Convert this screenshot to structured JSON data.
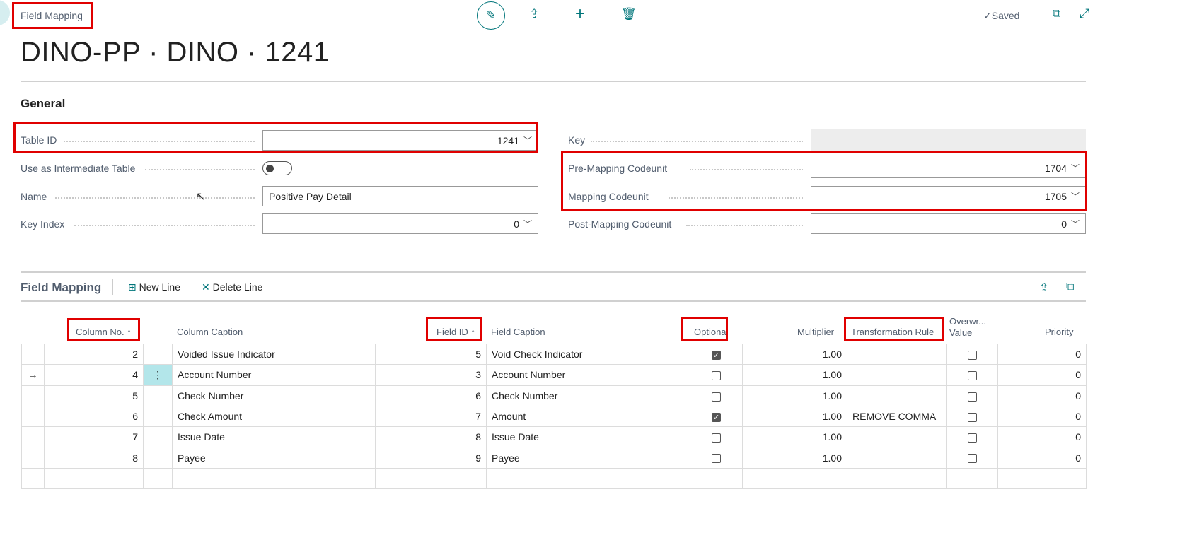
{
  "header": {
    "breadcrumb": "Field Mapping",
    "status": "Saved",
    "title": "DINO-PP · DINO · 1241"
  },
  "icons": {
    "edit": "pencil-icon",
    "share": "share-icon",
    "new": "plus-icon",
    "delete": "trash-icon",
    "saved": "check-icon",
    "open_new": "open-new-window-icon",
    "expand": "expand-icon"
  },
  "general": {
    "section_title": "General",
    "table_id": {
      "label": "Table ID",
      "value": "1241"
    },
    "use_as_intermediate": {
      "label": "Use as Intermediate Table",
      "value": false
    },
    "name": {
      "label": "Name",
      "value": "Positive Pay Detail"
    },
    "key_index": {
      "label": "Key Index",
      "value": "0"
    },
    "key": {
      "label": "Key",
      "value": ""
    },
    "pre_mapping": {
      "label": "Pre-Mapping Codeunit",
      "value": "1704"
    },
    "mapping": {
      "label": "Mapping Codeunit",
      "value": "1705"
    },
    "post_mapping": {
      "label": "Post-Mapping Codeunit",
      "value": "0"
    }
  },
  "lines": {
    "title": "Field Mapping",
    "new_line": "New Line",
    "delete_line": "Delete Line",
    "columns": {
      "column_no": "Column No. ↑",
      "column_caption": "Column Caption",
      "field_id": "Field ID ↑",
      "field_caption": "Field Caption",
      "optional": "Optional",
      "multiplier": "Multiplier",
      "transformation_rule": "Transformation Rule",
      "overwrite1": "Overwr...",
      "overwrite2": "Value",
      "priority": "Priority"
    },
    "rows": [
      {
        "column_no": "2",
        "column_caption": "Voided Issue Indicator",
        "field_id": "5",
        "field_caption": "Void Check Indicator",
        "optional": true,
        "multiplier": "1.00",
        "transformation_rule": "",
        "overwrite": false,
        "priority": "0"
      },
      {
        "column_no": "4",
        "column_caption": "Account Number",
        "field_id": "3",
        "field_caption": "Account Number",
        "optional": false,
        "multiplier": "1.00",
        "transformation_rule": "",
        "overwrite": false,
        "priority": "0",
        "current": true
      },
      {
        "column_no": "5",
        "column_caption": "Check Number",
        "field_id": "6",
        "field_caption": "Check Number",
        "optional": false,
        "multiplier": "1.00",
        "transformation_rule": "",
        "overwrite": false,
        "priority": "0"
      },
      {
        "column_no": "6",
        "column_caption": "Check Amount",
        "field_id": "7",
        "field_caption": "Amount",
        "optional": true,
        "multiplier": "1.00",
        "transformation_rule": "REMOVE COMMA",
        "overwrite": false,
        "priority": "0"
      },
      {
        "column_no": "7",
        "column_caption": "Issue Date",
        "field_id": "8",
        "field_caption": "Issue Date",
        "optional": false,
        "multiplier": "1.00",
        "transformation_rule": "",
        "overwrite": false,
        "priority": "0"
      },
      {
        "column_no": "8",
        "column_caption": "Payee",
        "field_id": "9",
        "field_caption": "Payee",
        "optional": false,
        "multiplier": "1.00",
        "transformation_rule": "",
        "overwrite": false,
        "priority": "0"
      }
    ]
  }
}
